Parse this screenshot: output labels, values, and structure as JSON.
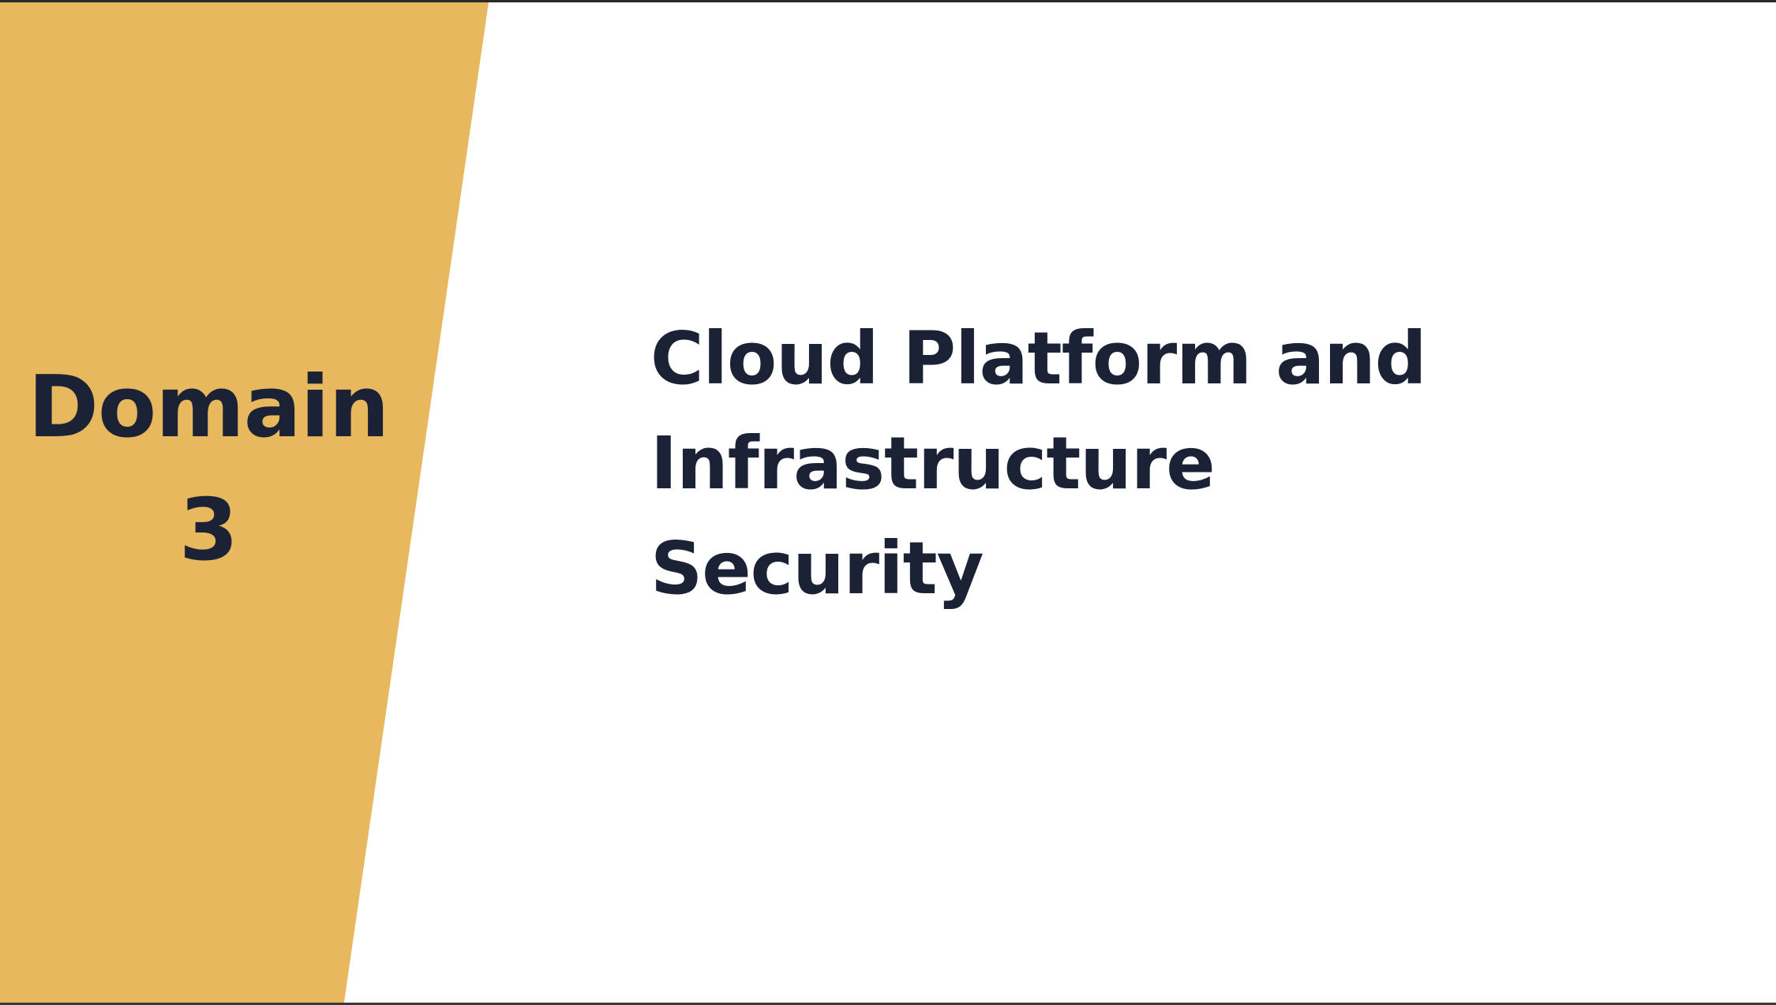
{
  "slide": {
    "accent_color": "#E8B85F",
    "text_color": "#1C2236",
    "background_color": "#FFFFFF",
    "domain": {
      "word": "Domain",
      "number": "3"
    },
    "title_lines": [
      "Cloud Platform and",
      "Infrastructure",
      "Security"
    ]
  }
}
